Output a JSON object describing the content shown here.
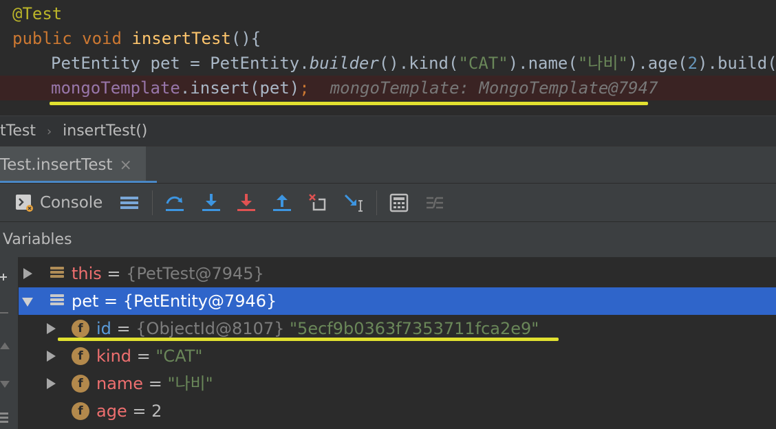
{
  "editor": {
    "line1": {
      "annotation": "@Test"
    },
    "line2": {
      "kw": "public void ",
      "method": "insertTest",
      "rest": "(){"
    },
    "line3": {
      "a": "PetEntity pet = PetEntity.",
      "b": "builder",
      "c": "().kind(",
      "d": "\"CAT\"",
      "e": ").name(",
      "f": "\"나비\"",
      "g": ").age(",
      "h": "2",
      "i": ").build();"
    },
    "line4": {
      "field": "mongoTemplate",
      "call": ".insert(pet)",
      "semi": ";",
      "inlay": "mongoTemplate: MongoTemplate@7947"
    }
  },
  "breadcrumb": {
    "class": "tTest",
    "method": "insertTest()",
    "sep": "›"
  },
  "tab": {
    "label": "Test.insertTest",
    "close": "×"
  },
  "toolbar": {
    "console_label": "Console"
  },
  "variables": {
    "header": "Variables",
    "rows": [
      {
        "name": "this",
        "eq": " = ",
        "ref": "{PetTest@7945}",
        "value": ""
      },
      {
        "name": "pet",
        "eq": " = ",
        "ref": "{PetEntity@7946}",
        "value": ""
      },
      {
        "name": "id",
        "eq": " = ",
        "ref": "{ObjectId@8107}",
        "value": " \"5ecf9b0363f7353711fca2e9\""
      },
      {
        "name": "kind",
        "eq": " = ",
        "ref": "",
        "value": "\"CAT\""
      },
      {
        "name": "name",
        "eq": " = ",
        "ref": "",
        "value": "\"나비\""
      },
      {
        "name": "age",
        "eq": " = ",
        "ref": "",
        "value": "2"
      }
    ],
    "field_badge": "f"
  },
  "colors": {
    "selection": "#2f65ca",
    "highlight": "#f5f531",
    "keyword": "#cc7832",
    "string": "#6a8759"
  }
}
